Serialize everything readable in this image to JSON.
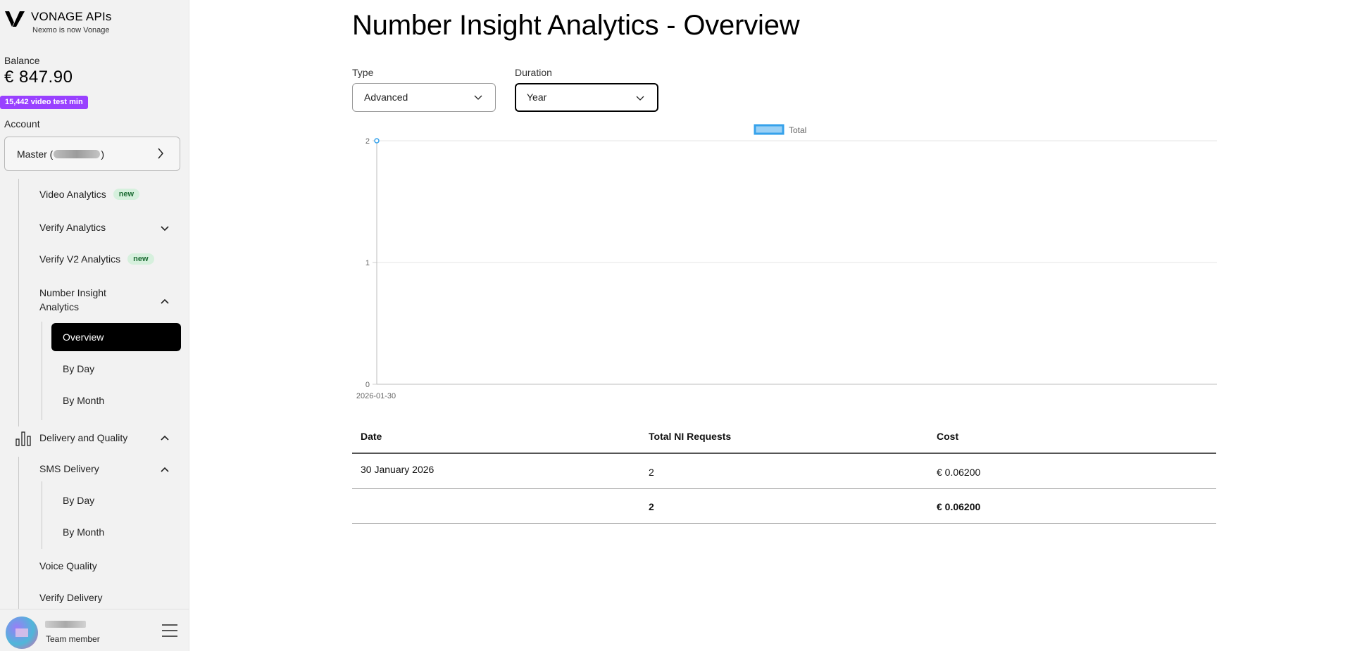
{
  "brand": {
    "name": "VONAGE APIs",
    "subtitle": "Nexmo is now Vonage"
  },
  "balance": {
    "label": "Balance",
    "value": "€ 847.90",
    "video_badge": "15,442 video test min"
  },
  "account": {
    "label": "Account",
    "prefix": "Master (",
    "suffix": ")"
  },
  "nav": {
    "video_analytics": "Video Analytics",
    "verify_analytics": "Verify Analytics",
    "verify_v2_analytics": "Verify V2 Analytics",
    "new_badge": "new",
    "number_insight_line1": "Number Insight",
    "number_insight_line2": "Analytics",
    "ni_overview": "Overview",
    "ni_by_day": "By Day",
    "ni_by_month": "By Month",
    "delivery_quality": "Delivery and Quality",
    "sms_delivery": "SMS Delivery",
    "sms_by_day": "By Day",
    "sms_by_month": "By Month",
    "voice_quality": "Voice Quality",
    "verify_delivery": "Verify Delivery"
  },
  "user": {
    "role": "Team member"
  },
  "page": {
    "title": "Number Insight Analytics - Overview",
    "type_label": "Type",
    "type_value": "Advanced",
    "duration_label": "Duration",
    "duration_value": "Year"
  },
  "chart_data": {
    "type": "line",
    "x": [
      "2026-01-30"
    ],
    "series": [
      {
        "name": "Total",
        "values": [
          2
        ]
      }
    ],
    "yticks": [
      "0",
      "1",
      "2"
    ],
    "ylim": [
      0,
      2
    ],
    "legend": "top-center",
    "grid": true,
    "colors": {
      "series": "#36a2eb",
      "fill": "#9ad0f5"
    }
  },
  "table": {
    "headers": [
      "Date",
      "Total NI Requests",
      "Cost"
    ],
    "rows": [
      {
        "date": "30 January 2026",
        "requests": "2",
        "cost": "€ 0.06200"
      }
    ],
    "totals": {
      "requests": "2",
      "cost": "€ 0.06200"
    }
  }
}
